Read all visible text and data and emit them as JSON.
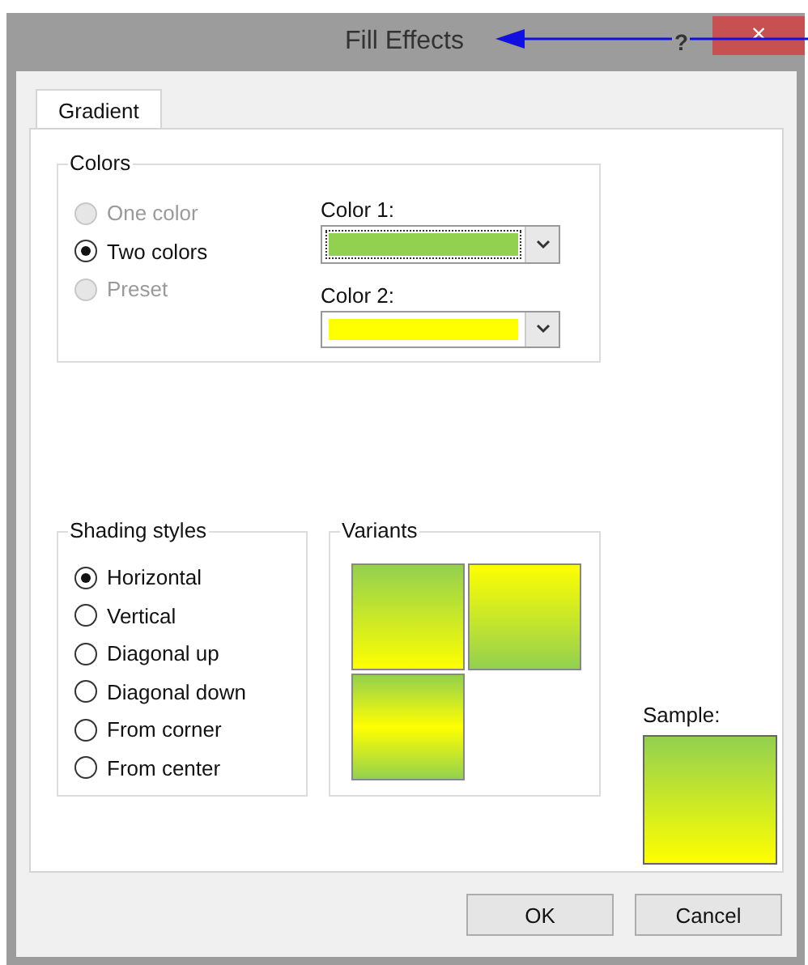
{
  "window": {
    "title": "Fill Effects",
    "help": "?",
    "close": "×"
  },
  "tabs": [
    {
      "label": "Gradient",
      "selected": true
    }
  ],
  "colors": {
    "title": "Colors",
    "options": [
      {
        "label": "One color",
        "selected": false,
        "disabled": true
      },
      {
        "label": "Two colors",
        "selected": true,
        "disabled": false
      },
      {
        "label": "Preset",
        "selected": false,
        "disabled": true
      }
    ],
    "pickers": [
      {
        "label": "Color 1:",
        "color": "#92d050",
        "focused": true
      },
      {
        "label": "Color 2:",
        "color": "#ffff00",
        "focused": false
      }
    ]
  },
  "shading": {
    "title": "Shading styles",
    "options": [
      {
        "label": "Horizontal",
        "selected": true
      },
      {
        "label": "Vertical",
        "selected": false
      },
      {
        "label": "Diagonal up",
        "selected": false
      },
      {
        "label": "Diagonal down",
        "selected": false
      },
      {
        "label": "From corner",
        "selected": false
      },
      {
        "label": "From center",
        "selected": false
      }
    ]
  },
  "variants": {
    "title": "Variants",
    "items": [
      {
        "kind": "down"
      },
      {
        "kind": "up"
      },
      {
        "kind": "center"
      }
    ]
  },
  "sample": {
    "label": "Sample:"
  },
  "buttons": [
    "OK",
    "Cancel"
  ]
}
